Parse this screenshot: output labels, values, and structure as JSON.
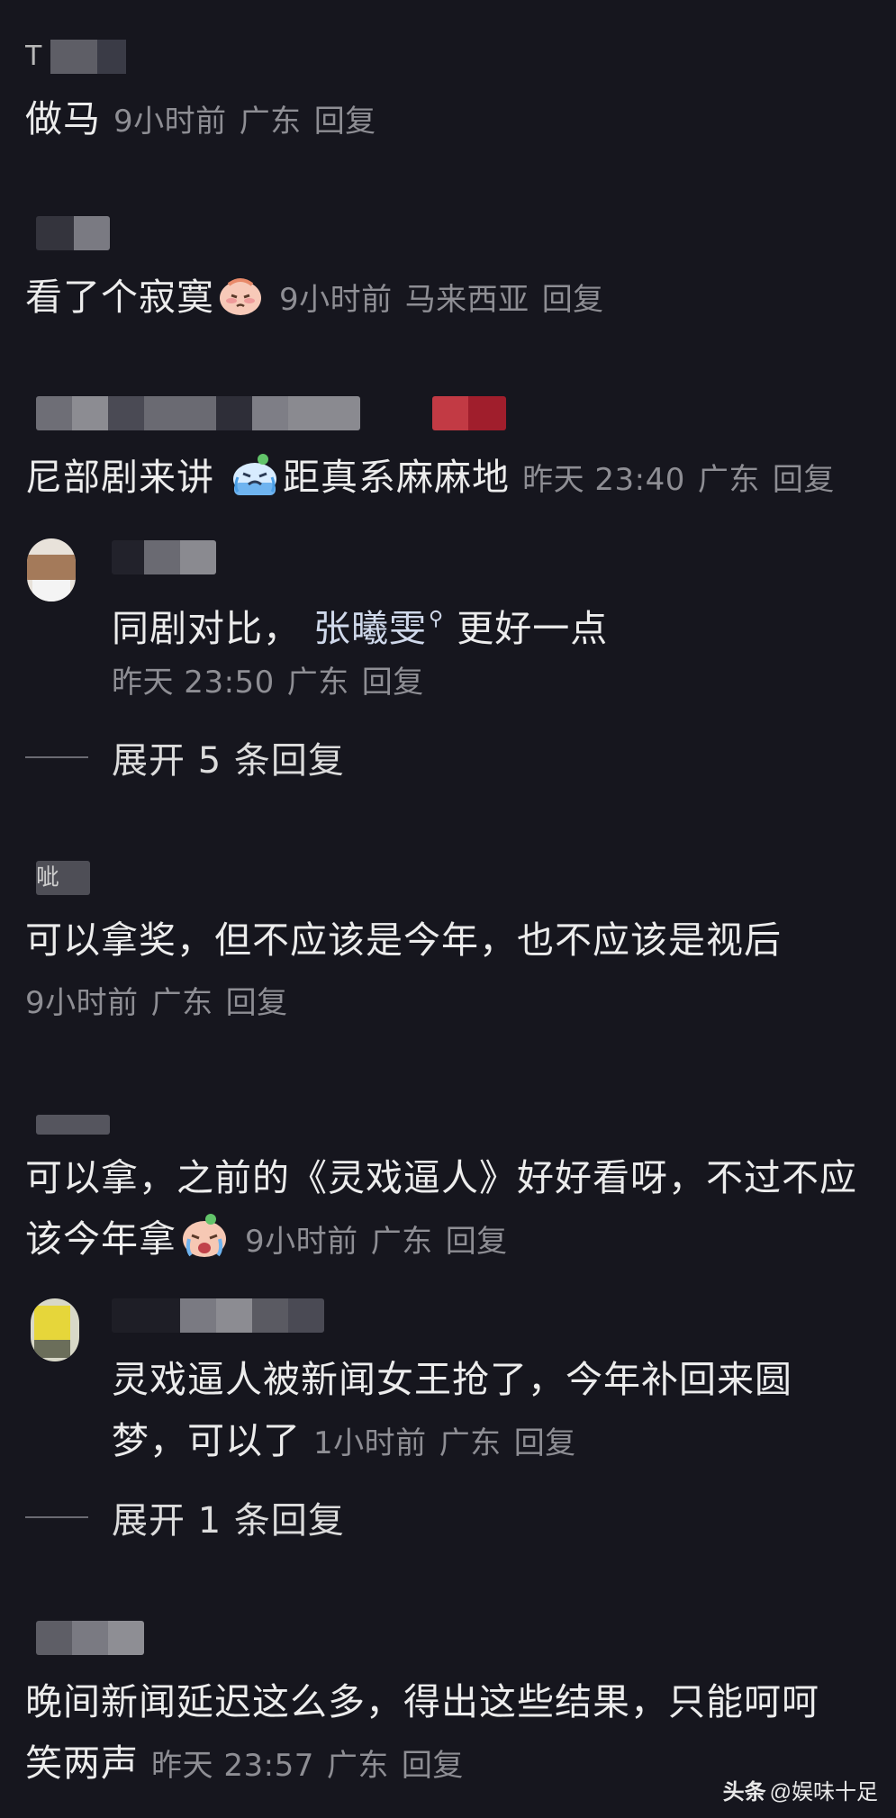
{
  "comments": [
    {
      "user_fragment": "T",
      "text": "做马",
      "time": "9小时前",
      "location": "广东",
      "reply_label": "回复"
    },
    {
      "text": "看了个寂寞",
      "emoji": "pleading-face-icon",
      "time": "9小时前",
      "location": "马来西亚",
      "reply_label": "回复"
    },
    {
      "text_before": "尼部剧来讲 ",
      "emoji": "crying-face-icon",
      "text_after": "距真系麻麻地",
      "time": "昨天 23:40",
      "location": "广东",
      "reply_label": "回复"
    }
  ],
  "reply_1": {
    "text_before": "同剧对比， ",
    "link_name": "张曦雯",
    "text_after": " 更好一点",
    "time": "昨天 23:50",
    "location": "广东",
    "reply_label": "回复"
  },
  "expand_1": "展开 5 条回复",
  "comment_4": {
    "user_fragment": "呲",
    "text": "可以拿奖，但不应该是今年，也不应该是视后",
    "time": "9小时前",
    "location": "广东",
    "reply_label": "回复"
  },
  "comment_5": {
    "line1": "可以拿，之前的《灵戏逼人》好好看呀，不过不应",
    "line2": "该今年拿",
    "emoji": "crying-face-icon",
    "time": "9小时前",
    "location": "广东",
    "reply_label": "回复"
  },
  "reply_2": {
    "line1": "灵戏逼人被新闻女王抢了，今年补回来圆",
    "line2": "梦，可以了",
    "time": "1小时前",
    "location": "广东",
    "reply_label": "回复"
  },
  "expand_2": "展开 1 条回复",
  "comment_6": {
    "line1": "晚间新闻延迟这么多，得出这些结果，只能呵呵",
    "line2": "笑两声",
    "time": "昨天 23:57",
    "location": "广东",
    "reply_label": "回复"
  },
  "watermark": {
    "brand": "头条",
    "handle": "@娱味十足"
  },
  "colors": {
    "background": "#16161e",
    "text": "#ececec",
    "meta": "#8e8e94"
  }
}
